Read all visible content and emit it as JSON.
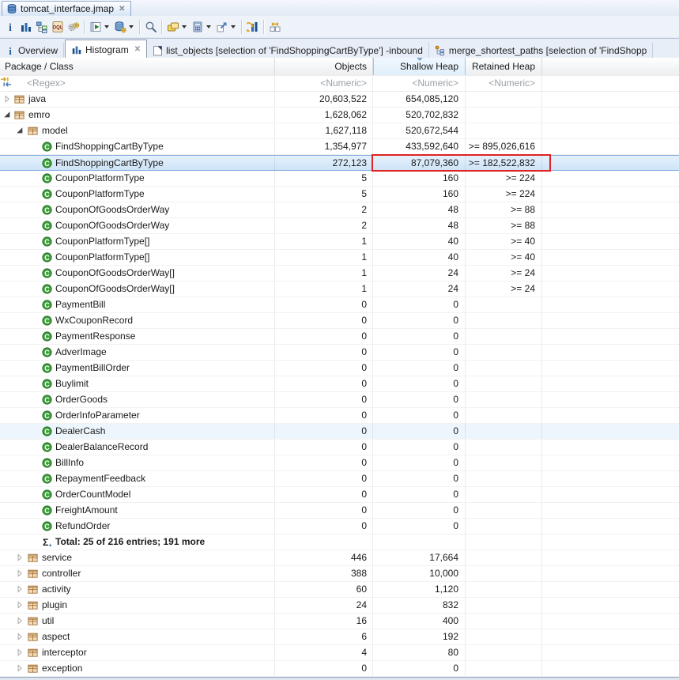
{
  "window": {
    "editor_tab_title": "tomcat_interface.jmap",
    "close_glyph": "✕"
  },
  "toolbar": {
    "icons": [
      {
        "name": "info-icon"
      },
      {
        "name": "create-histogram-icon"
      },
      {
        "name": "dominator-tree-icon"
      },
      {
        "name": "oql-icon"
      },
      {
        "name": "expert-system-icon"
      },
      {
        "name": "run-expert-test-icon",
        "has_dropdown": true
      },
      {
        "name": "query-browser-icon",
        "has_dropdown": true
      },
      {
        "name": "find-icon"
      },
      {
        "name": "group-result-icon",
        "has_dropdown": true
      },
      {
        "name": "calculate-retained-size-icon",
        "has_dropdown": true
      },
      {
        "name": "export-icon",
        "has_dropdown": true
      },
      {
        "name": "refresh-histogram-icon"
      },
      {
        "name": "compare-tables-icon"
      }
    ]
  },
  "view_tabs": [
    {
      "label": "Overview",
      "icon": "info-icon",
      "active": false
    },
    {
      "label": "Histogram",
      "icon": "histogram-icon",
      "active": true,
      "close_glyph": "✕"
    },
    {
      "label": "list_objects [selection of 'FindShoppingCartByType'] -inbound",
      "icon": "query-result-icon",
      "active": false
    },
    {
      "label": "merge_shortest_paths [selection of 'FindShopp",
      "icon": "merge-paths-icon",
      "active": false
    }
  ],
  "table": {
    "columns": [
      {
        "label": "Package / Class",
        "align": "left"
      },
      {
        "label": "Objects",
        "align": "right"
      },
      {
        "label": "Shallow Heap",
        "align": "right",
        "sorted": "desc"
      },
      {
        "label": "Retained Heap",
        "align": "right"
      }
    ],
    "filter_row": {
      "class_filter": "<Regex>",
      "objects": "<Numeric>",
      "shallow": "<Numeric>",
      "retained": "<Numeric>"
    },
    "rows": [
      {
        "label": "java",
        "kind": "package",
        "level": 0,
        "expand": "collapsed",
        "objects": "20,603,522",
        "shallow": "654,085,120",
        "retained": ""
      },
      {
        "label": "emro",
        "kind": "package",
        "level": 0,
        "expand": "expanded",
        "objects": "1,628,062",
        "shallow": "520,702,832",
        "retained": ""
      },
      {
        "label": "model",
        "kind": "package",
        "level": 1,
        "expand": "expanded",
        "objects": "1,627,118",
        "shallow": "520,672,544",
        "retained": ""
      },
      {
        "label": "FindShoppingCartByType",
        "kind": "class",
        "level": 2,
        "objects": "1,354,977",
        "shallow": "433,592,640",
        "retained": ">= 895,026,616"
      },
      {
        "label": "FindShoppingCartByType",
        "kind": "class",
        "level": 2,
        "selected": true,
        "annotated": true,
        "objects": "272,123",
        "shallow": "87,079,360",
        "retained": ">= 182,522,832"
      },
      {
        "label": "CouponPlatformType",
        "kind": "class",
        "level": 2,
        "objects": "5",
        "shallow": "160",
        "retained": ">= 224"
      },
      {
        "label": "CouponPlatformType",
        "kind": "class",
        "level": 2,
        "objects": "5",
        "shallow": "160",
        "retained": ">= 224"
      },
      {
        "label": "CouponOfGoodsOrderWay",
        "kind": "class",
        "level": 2,
        "objects": "2",
        "shallow": "48",
        "retained": ">= 88"
      },
      {
        "label": "CouponOfGoodsOrderWay",
        "kind": "class",
        "level": 2,
        "objects": "2",
        "shallow": "48",
        "retained": ">= 88"
      },
      {
        "label": "CouponPlatformType[]",
        "kind": "class",
        "level": 2,
        "objects": "1",
        "shallow": "40",
        "retained": ">= 40"
      },
      {
        "label": "CouponPlatformType[]",
        "kind": "class",
        "level": 2,
        "objects": "1",
        "shallow": "40",
        "retained": ">= 40"
      },
      {
        "label": "CouponOfGoodsOrderWay[]",
        "kind": "class",
        "level": 2,
        "objects": "1",
        "shallow": "24",
        "retained": ">= 24"
      },
      {
        "label": "CouponOfGoodsOrderWay[]",
        "kind": "class",
        "level": 2,
        "objects": "1",
        "shallow": "24",
        "retained": ">= 24"
      },
      {
        "label": "PaymentBill",
        "kind": "class",
        "level": 2,
        "objects": "0",
        "shallow": "0",
        "retained": ""
      },
      {
        "label": "WxCouponRecord",
        "kind": "class",
        "level": 2,
        "objects": "0",
        "shallow": "0",
        "retained": ""
      },
      {
        "label": "PaymentResponse",
        "kind": "class",
        "level": 2,
        "objects": "0",
        "shallow": "0",
        "retained": ""
      },
      {
        "label": "AdverImage",
        "kind": "class",
        "level": 2,
        "objects": "0",
        "shallow": "0",
        "retained": ""
      },
      {
        "label": "PaymentBillOrder",
        "kind": "class",
        "level": 2,
        "objects": "0",
        "shallow": "0",
        "retained": ""
      },
      {
        "label": "Buylimit",
        "kind": "class",
        "level": 2,
        "objects": "0",
        "shallow": "0",
        "retained": ""
      },
      {
        "label": "OrderGoods",
        "kind": "class",
        "level": 2,
        "objects": "0",
        "shallow": "0",
        "retained": ""
      },
      {
        "label": "OrderInfoParameter",
        "kind": "class",
        "level": 2,
        "objects": "0",
        "shallow": "0",
        "retained": ""
      },
      {
        "label": "DealerCash",
        "kind": "class",
        "level": 2,
        "hover": true,
        "objects": "0",
        "shallow": "0",
        "retained": ""
      },
      {
        "label": "DealerBalanceRecord",
        "kind": "class",
        "level": 2,
        "objects": "0",
        "shallow": "0",
        "retained": ""
      },
      {
        "label": "BillInfo",
        "kind": "class",
        "level": 2,
        "objects": "0",
        "shallow": "0",
        "retained": ""
      },
      {
        "label": "RepaymentFeedback",
        "kind": "class",
        "level": 2,
        "objects": "0",
        "shallow": "0",
        "retained": ""
      },
      {
        "label": "OrderCountModel",
        "kind": "class",
        "level": 2,
        "objects": "0",
        "shallow": "0",
        "retained": ""
      },
      {
        "label": "FreightAmount",
        "kind": "class",
        "level": 2,
        "objects": "0",
        "shallow": "0",
        "retained": ""
      },
      {
        "label": "RefundOrder",
        "kind": "class",
        "level": 2,
        "objects": "0",
        "shallow": "0",
        "retained": ""
      },
      {
        "label": "Total: 25 of 216 entries; 191 more",
        "kind": "total",
        "level": 2,
        "objects": "",
        "shallow": "",
        "retained": ""
      },
      {
        "label": "service",
        "kind": "package",
        "level": 1,
        "expand": "collapsed",
        "objects": "446",
        "shallow": "17,664",
        "retained": ""
      },
      {
        "label": "controller",
        "kind": "package",
        "level": 1,
        "expand": "collapsed",
        "objects": "388",
        "shallow": "10,000",
        "retained": ""
      },
      {
        "label": "activity",
        "kind": "package",
        "level": 1,
        "expand": "collapsed",
        "objects": "60",
        "shallow": "1,120",
        "retained": ""
      },
      {
        "label": "plugin",
        "kind": "package",
        "level": 1,
        "expand": "collapsed",
        "objects": "24",
        "shallow": "832",
        "retained": ""
      },
      {
        "label": "util",
        "kind": "package",
        "level": 1,
        "expand": "collapsed",
        "objects": "16",
        "shallow": "400",
        "retained": ""
      },
      {
        "label": "aspect",
        "kind": "package",
        "level": 1,
        "expand": "collapsed",
        "objects": "6",
        "shallow": "192",
        "retained": ""
      },
      {
        "label": "interceptor",
        "kind": "package",
        "level": 1,
        "expand": "collapsed",
        "objects": "4",
        "shallow": "80",
        "retained": ""
      },
      {
        "label": "exception",
        "kind": "package",
        "level": 1,
        "expand": "collapsed",
        "objects": "0",
        "shallow": "0",
        "retained": ""
      }
    ]
  },
  "annotation": {
    "color": "#e12222",
    "target_row_label": "FindShoppingCartByType",
    "covers_columns": [
      "Shallow Heap",
      "Retained Heap"
    ]
  }
}
